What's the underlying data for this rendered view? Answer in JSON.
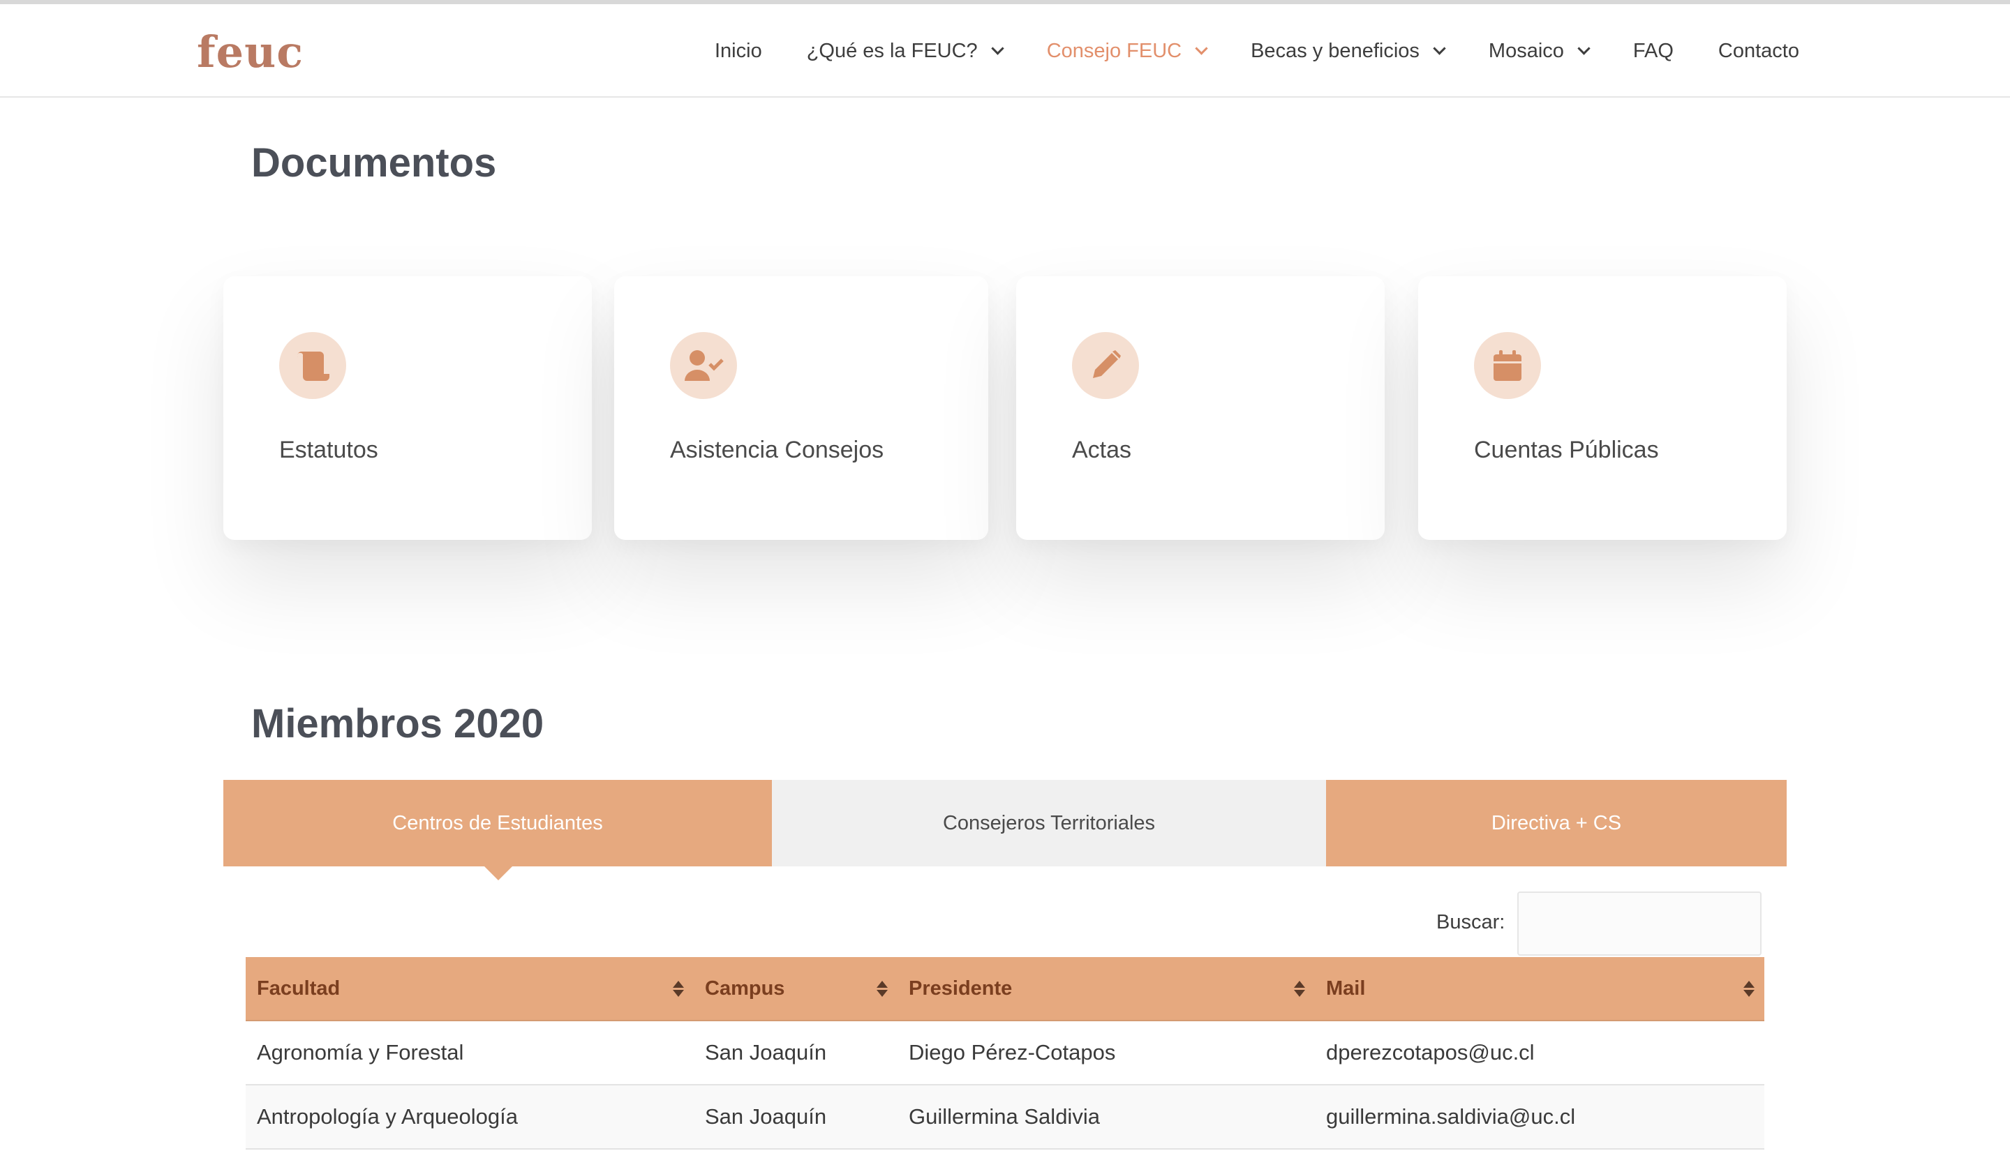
{
  "header": {
    "logo": "feuc",
    "nav": [
      {
        "label": "Inicio",
        "dropdown": false,
        "active": false
      },
      {
        "label": "¿Qué es la FEUC?",
        "dropdown": true,
        "active": false
      },
      {
        "label": "Consejo FEUC",
        "dropdown": true,
        "active": true
      },
      {
        "label": "Becas y beneficios",
        "dropdown": true,
        "active": false
      },
      {
        "label": "Mosaico",
        "dropdown": true,
        "active": false
      },
      {
        "label": "FAQ",
        "dropdown": false,
        "active": false
      },
      {
        "label": "Contacto",
        "dropdown": false,
        "active": false
      }
    ]
  },
  "documents": {
    "title": "Documentos",
    "cards": [
      {
        "label": "Estatutos",
        "icon": "scroll-icon"
      },
      {
        "label": "Asistencia Consejos",
        "icon": "user-check-icon"
      },
      {
        "label": "Actas",
        "icon": "pencil-icon"
      },
      {
        "label": "Cuentas Públicas",
        "icon": "calendar-icon"
      }
    ]
  },
  "members": {
    "title": "Miembros 2020",
    "tabs": [
      {
        "label": "Centros de Estudiantes",
        "active": true
      },
      {
        "label": "Consejeros Territoriales",
        "active": false
      },
      {
        "label": "Directiva + CS",
        "active": false
      }
    ],
    "search": {
      "label": "Buscar:",
      "value": ""
    },
    "table": {
      "headers": [
        "Facultad",
        "Campus",
        "Presidente",
        "Mail"
      ],
      "rows": [
        [
          "Agronomía y Forestal",
          "San Joaquín",
          "Diego Pérez-Cotapos",
          "dperezcotapos@uc.cl"
        ],
        [
          "Antropología y Arqueología",
          "San Joaquín",
          "Guillermina Saldivia",
          "guillermina.saldivia@uc.cl"
        ]
      ]
    }
  },
  "colors": {
    "accent": "#e6a97f",
    "accent_text": "#e28f6b",
    "icon_bg": "#f5dfd1",
    "icon_fg": "#d68f66",
    "logo": "#b97a63"
  }
}
